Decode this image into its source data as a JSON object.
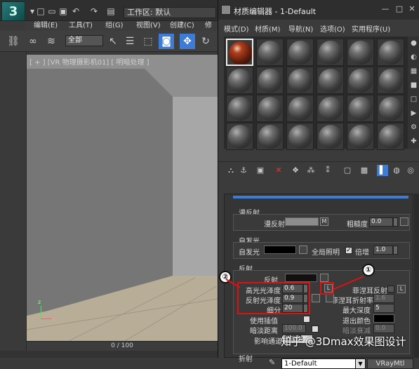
{
  "main": {
    "logo": "3",
    "workspace_label": "工作区: 默认",
    "menus": [
      "编辑(E)",
      "工具(T)",
      "组(G)",
      "视图(V)",
      "创建(C)",
      "修"
    ],
    "selection_set": "全部",
    "viewport_label": "[ + ] [VR 物理摄影机01] [ 明暗处理 ]",
    "time_slider": "0 / 100",
    "axis_z": "z",
    "axis_x": "x"
  },
  "mat": {
    "title": "材质编辑器 - 1-Default",
    "menus": [
      "模式(D)",
      "材质(M)",
      "导航(N)",
      "选项(O)",
      "实用程序(U)"
    ],
    "name": "1-Default",
    "type": "VRayMtl",
    "diffuse_group": {
      "title": "漫反射",
      "diffuse_label": "漫反射",
      "map_btn": "M",
      "roughness_label": "粗糙度",
      "roughness_value": "0.0"
    },
    "selfillum_group": {
      "title": "自发光",
      "selfillum_label": "自发光",
      "gi_label": "全局照明",
      "mult_label": "倍增",
      "mult_value": "1.0",
      "gi_check": "✓"
    },
    "reflect_group": {
      "title": "反射",
      "reflect_label": "反射",
      "hilight_label": "高光光泽度",
      "hilight_value": "0.6",
      "refl_gloss_label": "反射光泽度",
      "refl_gloss_value": "0.9",
      "subdivs_label": "细分",
      "subdivs_value": "20",
      "use_interp_label": "使用插值",
      "dim_dist_label": "暗淡距离",
      "dim_dist_value": "100.0",
      "affect_ch_label": "影响通道",
      "affect_ch_value": "仅颜色",
      "fresnel_label": "菲涅耳反射",
      "fresnel_ior_label": "菲涅耳折射率",
      "fresnel_ior_value": "1.6",
      "max_depth_label": "最大深度",
      "max_depth_value": "5",
      "exit_color_label": "退出颜色",
      "dim_falloff_label": "暗淡衰减",
      "dim_falloff_value": "0.0",
      "lock_btn": "L"
    },
    "refract_title": "折射"
  },
  "annotations": {
    "callout_1": "①",
    "callout_2": "②"
  },
  "watermark": "知乎 @3Dmax效果图设计"
}
